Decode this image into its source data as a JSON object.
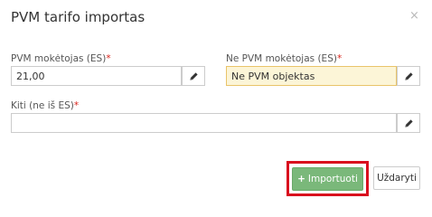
{
  "dialog": {
    "title": "PVM tarifo importas",
    "close_icon": "×"
  },
  "fields": {
    "pvm_payer": {
      "label": "PVM mokėtojas (ES)",
      "required_mark": "*",
      "value": "21,00"
    },
    "non_pvm_payer": {
      "label": "Ne PVM mokėtojas (ES)",
      "required_mark": "*",
      "value": "Ne PVM objektas"
    },
    "other": {
      "label": "Kiti (ne iš ES)",
      "required_mark": "*",
      "value": ""
    }
  },
  "buttons": {
    "import_icon": "+",
    "import_label": "Importuoti",
    "close_label": "Uždaryti"
  },
  "colors": {
    "import_button": "#7ab87a",
    "highlight_frame": "#d90f1e",
    "required_mark": "#d9241c",
    "highlight_field": "#fcf5d7"
  },
  "icons": [
    "pencil-icon"
  ]
}
